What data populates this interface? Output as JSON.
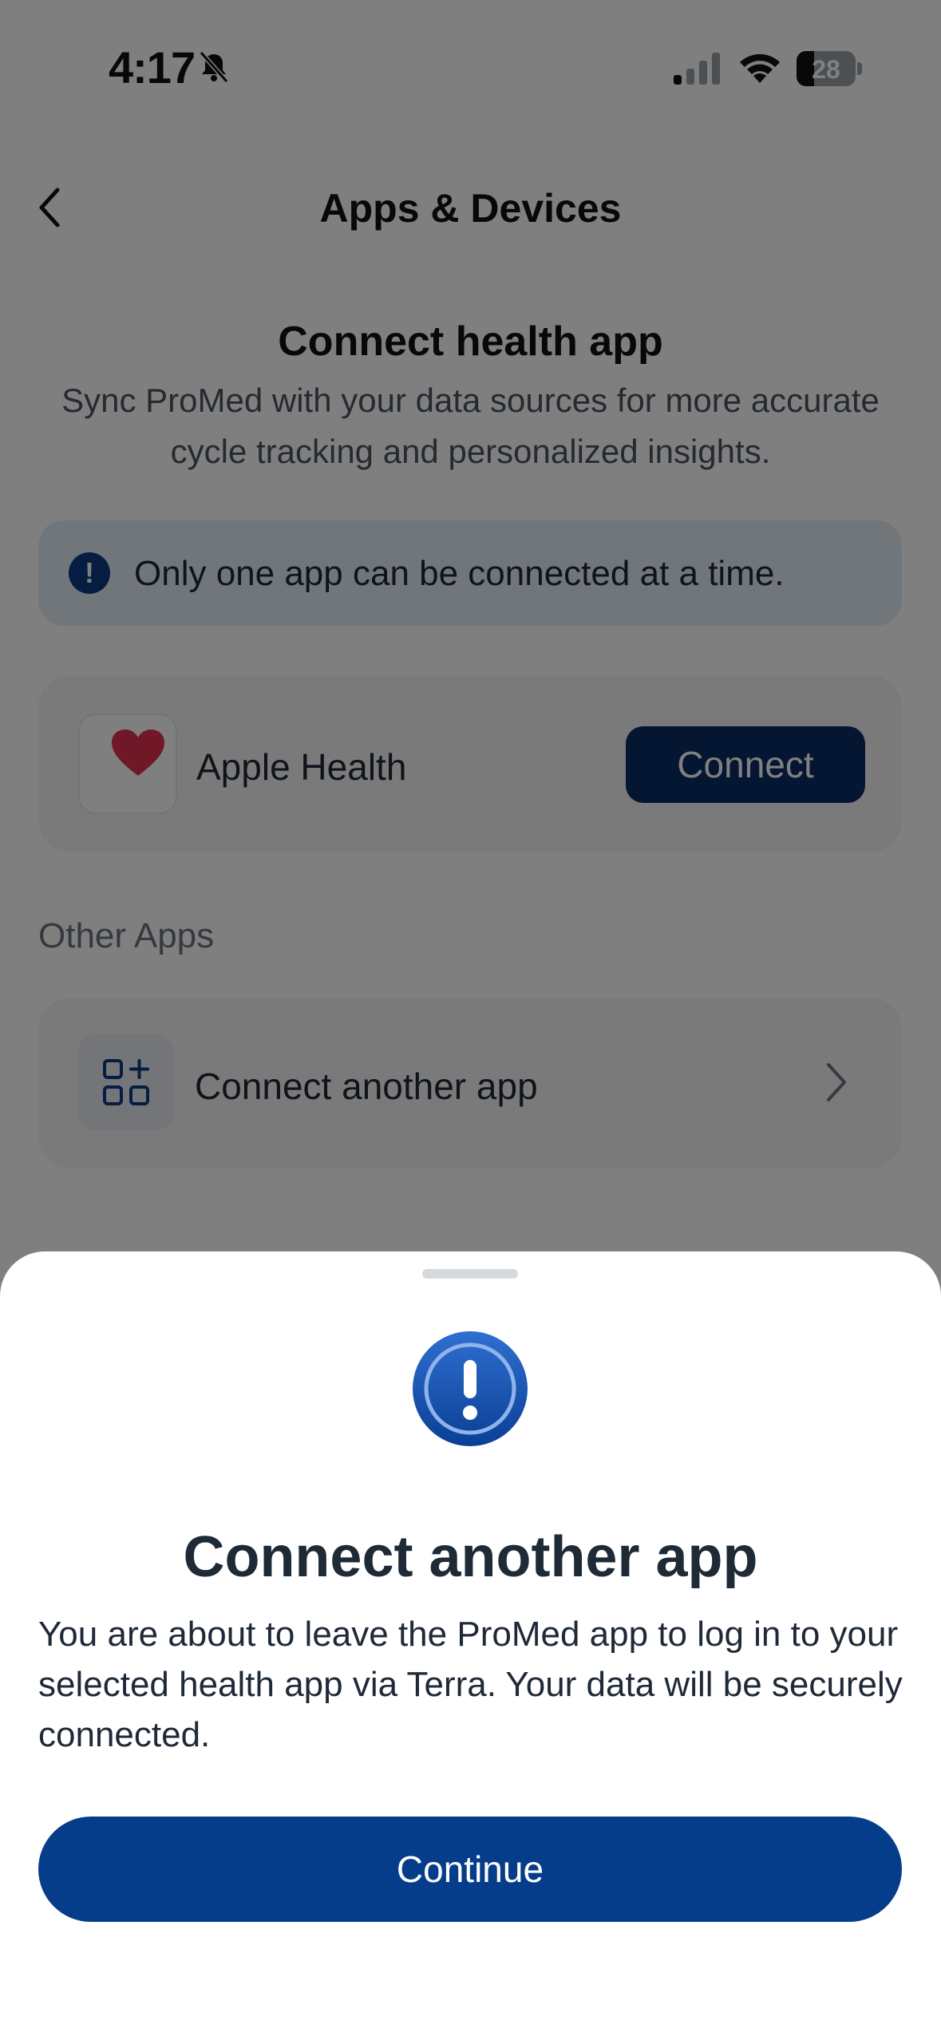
{
  "status_bar": {
    "time": "4:17",
    "battery_percent": "28",
    "icons": [
      "bell-slash-icon",
      "cellular-signal-icon",
      "wifi-icon",
      "battery-icon"
    ]
  },
  "header": {
    "title": "Apps & Devices",
    "back_icon": "chevron-left-icon"
  },
  "connect_section": {
    "title": "Connect health app",
    "subtitle": "Sync ProMed with your data sources for more accurate cycle tracking and personalized insights.",
    "info_banner": "Only one app can be connected at a time.",
    "info_icon": "info-icon"
  },
  "apple_health": {
    "name": "Apple Health",
    "icon": "heart-icon",
    "button_label": "Connect"
  },
  "other_apps": {
    "section_label": "Other Apps",
    "item_label": "Connect another app",
    "item_icon": "apps-grid-icon",
    "chevron_icon": "chevron-right-icon"
  },
  "sheet": {
    "icon": "alert-icon",
    "title": "Connect another app",
    "body": "You are about to leave the ProMed app to log in to your selected health app via Terra. Your data will be securely connected.",
    "button_label": "Continue"
  },
  "colors": {
    "primary": "#063d8a",
    "connect_button": "#0a2c66",
    "heart": "#e0304f",
    "info_banner_bg": "#e3ecf7"
  }
}
